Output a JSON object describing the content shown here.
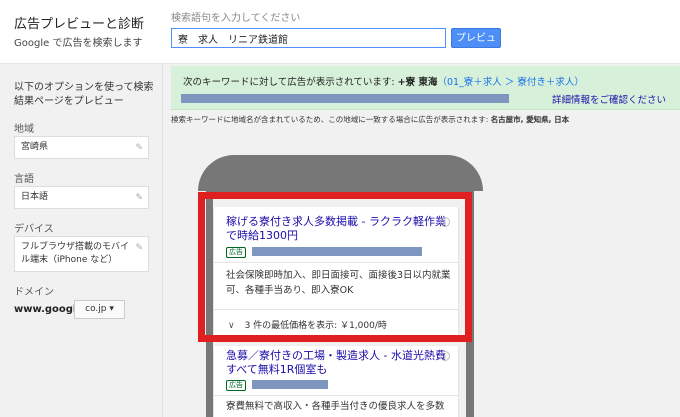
{
  "header": {
    "title": "広告プレビューと診断",
    "subtitle": "Google で広告を検索します",
    "search_label": "検索語句を入力してください",
    "search_value": "寮　求人　リニア鉄道館",
    "preview_label": "プレビュー"
  },
  "sidebar": {
    "intro": "以下のオプションを使って検索結果ページをプレビュー",
    "region_label": "地域",
    "region_value": "宮崎県",
    "language_label": "言語",
    "language_value": "日本語",
    "device_label": "デバイス",
    "device_value": "フルブラウザ搭載のモバイル端末（iPhone など）",
    "domain_label": "ドメイン",
    "domain_prefix": "www.google.",
    "domain_value": "co.jp ▾"
  },
  "main": {
    "notice_prefix": "次のキーワードに対して広告が表示されています: ",
    "notice_keyword": "+寮 東海",
    "notice_group": "（01_寮＋求人 ＞ 寮付き＋求人）",
    "detail_link": "詳細情報をご確認ください",
    "region_note_prefix": "検索キーワードに地域名が含まれているため、この地域に一致する場合に広告が表示されます: ",
    "region_note_places": "名古屋市, 愛知県, 日本"
  },
  "ads": [
    {
      "title": "稼げる寮付き求人多数掲載 - ラクラク軽作業で時給1300円",
      "badge": "広告",
      "description": "社会保険即時加入、即日面接可、面接後3日以内就業可、各種手当あり、即入寮OK",
      "price_text": "3 件の最低価格を表示: ￥1,000/時"
    },
    {
      "title": "急募／寮付きの工場・製造求人 - 水道光熱費すべて無料1R個室も",
      "badge": "広告",
      "description": "寮費無料で高収入・各種手当付きの優良求人を多数"
    }
  ],
  "colors": {
    "accent_blue": "#4d8ff7",
    "notice_green": "#d7f0d9",
    "highlight_red": "#e02020",
    "link_blue": "#1a0dab"
  }
}
